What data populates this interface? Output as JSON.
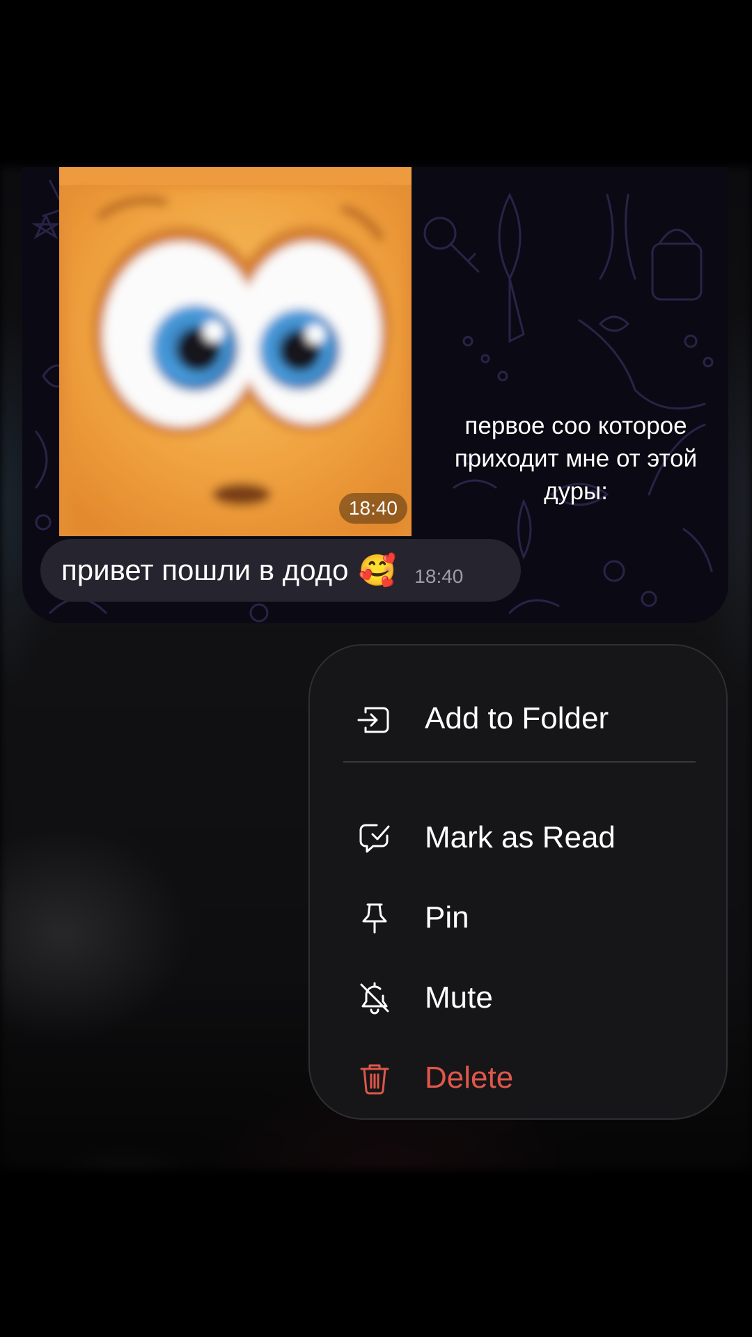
{
  "chat": {
    "photo_timestamp": "18:40",
    "caption": "первое соо которое приходит мне от этой дуры:",
    "message": {
      "text": "привет пошли в додо",
      "emoji": "🥰",
      "time": "18:40"
    }
  },
  "context_menu": {
    "items": [
      {
        "label": "Add to Folder",
        "icon": "folder-add-icon"
      },
      {
        "label": "Mark as Read",
        "icon": "mark-read-icon"
      },
      {
        "label": "Pin",
        "icon": "pin-icon"
      },
      {
        "label": "Mute",
        "icon": "bell-off-icon"
      },
      {
        "label": "Delete",
        "icon": "trash-icon",
        "color": "#e0574a"
      }
    ]
  },
  "colors": {
    "menu_background": "#161618",
    "danger": "#e0574a",
    "bubble": "#26242f"
  }
}
